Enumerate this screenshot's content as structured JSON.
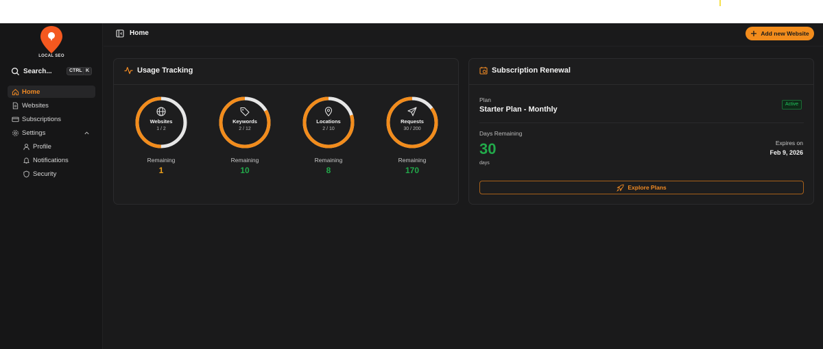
{
  "brand": {
    "logo_text": "LOCAL SEO",
    "accent": "#f28c1c"
  },
  "search": {
    "label": "Search...",
    "kbd_ctrl": "CTRL",
    "kbd_key": "K"
  },
  "sidebar": {
    "items": [
      {
        "label": "Home",
        "icon": "home-icon",
        "active": true
      },
      {
        "label": "Websites",
        "icon": "document-icon"
      },
      {
        "label": "Subscriptions",
        "icon": "card-icon"
      },
      {
        "label": "Settings",
        "icon": "gear-icon",
        "expanded": true
      }
    ],
    "sub_items": [
      {
        "label": "Profile",
        "icon": "user-icon"
      },
      {
        "label": "Notifications",
        "icon": "bell-icon"
      },
      {
        "label": "Security",
        "icon": "shield-icon"
      }
    ]
  },
  "header": {
    "title": "Home",
    "add_button": "Add new Website"
  },
  "usage": {
    "title": "Usage Tracking",
    "remaining_label": "Remaining",
    "rings": [
      {
        "label": "Websites",
        "count": "1 / 2",
        "used": 1,
        "total": 2,
        "remaining": "1",
        "remaining_color": "#f0a21a",
        "icon": "globe-icon"
      },
      {
        "label": "Keywords",
        "count": "2 / 12",
        "used": 2,
        "total": 12,
        "remaining": "10",
        "remaining_color": "#22a94a",
        "icon": "tag-icon"
      },
      {
        "label": "Locations",
        "count": "2 / 10",
        "used": 2,
        "total": 10,
        "remaining": "8",
        "remaining_color": "#22a94a",
        "icon": "map-pin-icon"
      },
      {
        "label": "Requests",
        "count": "30 / 200",
        "used": 30,
        "total": 200,
        "remaining": "170",
        "remaining_color": "#22a94a",
        "icon": "send-icon"
      }
    ]
  },
  "subscription": {
    "title": "Subscription Renewal",
    "plan_label": "Plan",
    "plan_name": "Starter Plan - Monthly",
    "status": "Active",
    "days_label": "Days Remaining",
    "days_value": "30",
    "days_unit": "days",
    "expires_label": "Expires on",
    "expires_date": "Feb 9, 2026",
    "explore_button": "Explore Plans"
  }
}
